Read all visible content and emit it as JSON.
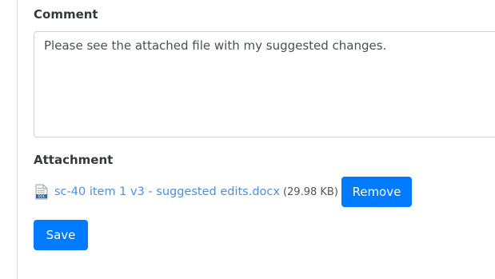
{
  "comment": {
    "label": "Comment",
    "value": "Please see the attached file with my suggested changes."
  },
  "attachment": {
    "label": "Attachment",
    "file_icon": "docx-file-icon",
    "file_name": "sc-40 item 1 v3 - suggested edits.docx",
    "file_size": "(29.98 KB)",
    "remove_label": "Remove"
  },
  "actions": {
    "save_label": "Save"
  },
  "colors": {
    "primary": "#007bff",
    "link": "#4a90e2",
    "border": "#ced4da"
  }
}
